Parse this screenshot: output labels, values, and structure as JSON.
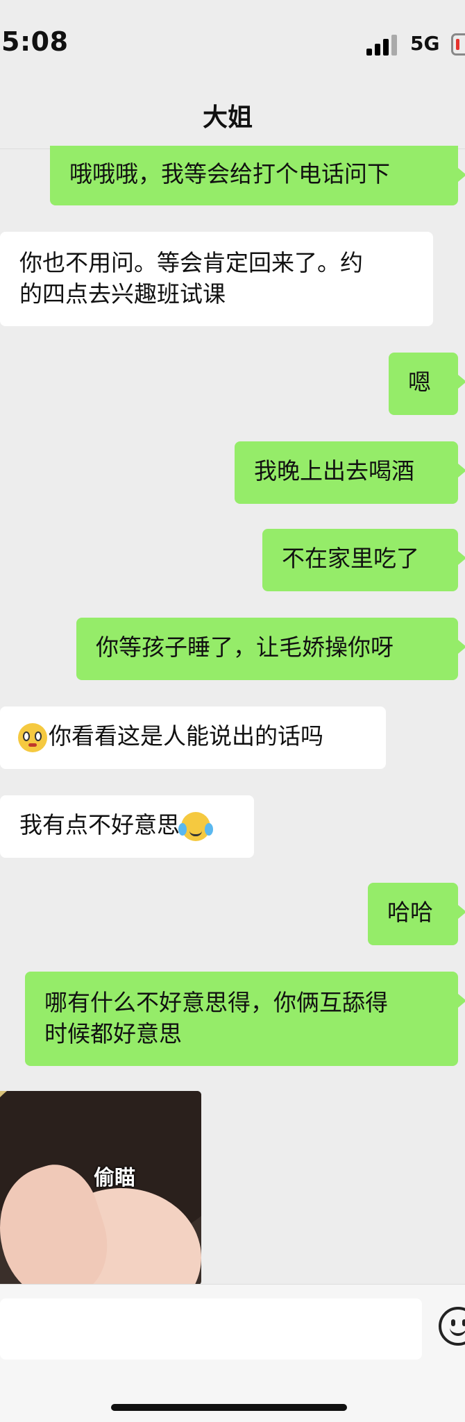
{
  "status_bar": {
    "time": "5:08",
    "network": "5G"
  },
  "header": {
    "title": "大姐"
  },
  "messages": [
    {
      "side": "out",
      "text": "哦哦哦，我等会给打个电话问下"
    },
    {
      "side": "in",
      "line1": "你也不用问。等会肯定回来了。约",
      "line2": "的四点去兴趣班试课"
    },
    {
      "side": "out",
      "text": "嗯"
    },
    {
      "side": "out",
      "text": "我晚上出去喝酒"
    },
    {
      "side": "out",
      "text": "不在家里吃了"
    },
    {
      "side": "out",
      "text": "你等孩子睡了，让毛娇操你呀"
    },
    {
      "side": "in",
      "text": "你看看这是人能说出的话吗",
      "emoji": "flushed-face-emoji"
    },
    {
      "side": "in",
      "text": "我有点不好意思",
      "emoji": "crying-laughing-emoji"
    },
    {
      "side": "out",
      "text": "哈哈"
    },
    {
      "side": "out",
      "line1": "哪有什么不好意思得，你俩互舔得",
      "line2": "时候都好意思"
    },
    {
      "side": "in",
      "type": "sticker",
      "caption": "偷瞄"
    }
  ],
  "icons": {
    "emoji_button": "smiley-face-icon"
  }
}
